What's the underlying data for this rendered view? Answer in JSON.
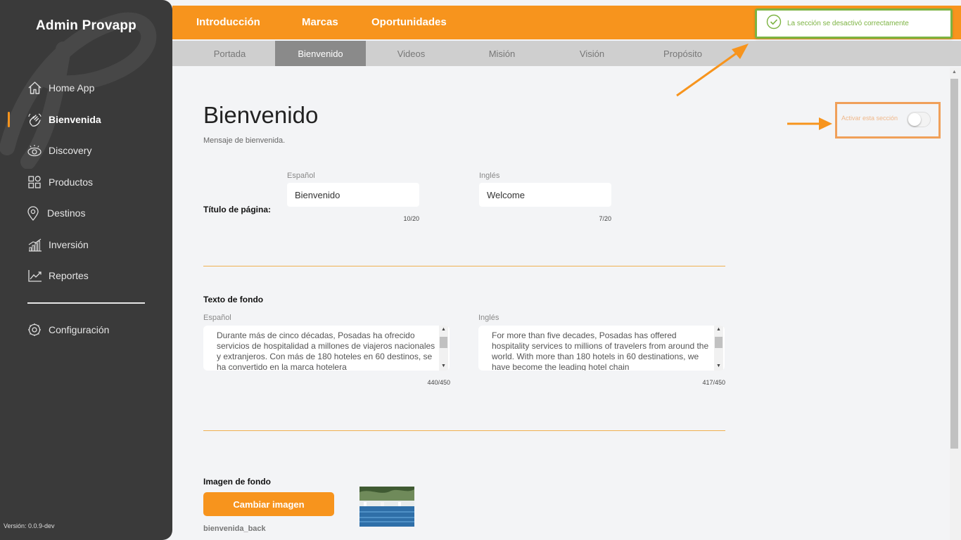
{
  "sidebar": {
    "app_title": "Admin Provapp",
    "items": [
      {
        "label": "Home App",
        "icon": "home-icon"
      },
      {
        "label": "Bienvenida",
        "icon": "waving-hand-icon",
        "active": true
      },
      {
        "label": "Discovery",
        "icon": "eye-icon"
      },
      {
        "label": "Productos",
        "icon": "products-grid-icon"
      },
      {
        "label": "Destinos",
        "icon": "map-pin-icon"
      },
      {
        "label": "Inversión",
        "icon": "bar-chart-icon"
      },
      {
        "label": "Reportes",
        "icon": "line-chart-icon"
      }
    ],
    "settings": {
      "label": "Configuración",
      "icon": "gear-icon"
    },
    "version": "Versión: 0.0.9-dev"
  },
  "topbar": {
    "tabs": [
      "Introducción",
      "Marcas",
      "Oportunidades"
    ]
  },
  "subnav": {
    "tabs": [
      "Portada",
      "Bienvenido",
      "Videos",
      "Misión",
      "Visión",
      "Propósito"
    ],
    "active": "Bienvenido"
  },
  "toast": {
    "message": "La sección se desactivó correctamente",
    "icon": "check-circle-icon"
  },
  "main": {
    "title": "Bienvenido",
    "subtitle": "Mensaje de bienvenida.",
    "activate": {
      "label": "Activar esta sección",
      "enabled": false
    },
    "page_title_field": {
      "label": "Título de página:",
      "es_label": "Español",
      "es_value": "Bienvenido",
      "es_counter": "10/20",
      "en_label": "Inglés",
      "en_value": "Welcome",
      "en_counter": "7/20"
    },
    "background_text": {
      "label": "Texto de fondo",
      "es_label": "Español",
      "es_value": "Durante más de cinco décadas, Posadas ha ofrecido servicios de hospitalidad a millones de viajeros nacionales y extranjeros. Con más de 180 hoteles en 60 destinos, se ha convertido en la marca hotelera",
      "es_counter": "440/450",
      "en_label": "Inglés",
      "en_value": "For more than five decades, Posadas has offered hospitality services to millions of travelers from around the world. With more than 180 hotels in 60 destinations, we have become the leading hotel chain",
      "en_counter": "417/450"
    },
    "background_image": {
      "label": "Imagen de fondo",
      "button": "Cambiar imagen",
      "filename": "bienvenida_back"
    }
  },
  "colors": {
    "accent": "#f7941d",
    "sidebar": "#3a3a3a",
    "success": "#7cb342",
    "annotation": "#f0a05a"
  }
}
